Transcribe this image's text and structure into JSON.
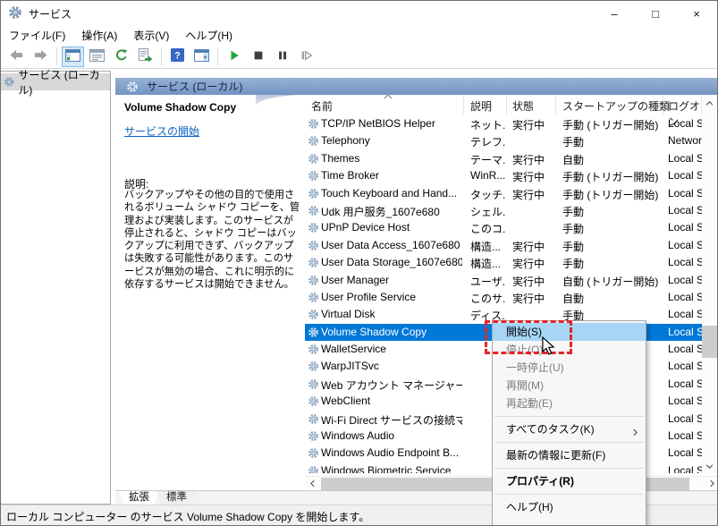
{
  "window": {
    "title": "サービス",
    "controls": {
      "minimize": "–",
      "maximize": "□",
      "close": "×"
    }
  },
  "menubar": {
    "items": [
      {
        "id": "file",
        "label": "ファイル(F)"
      },
      {
        "id": "action",
        "label": "操作(A)"
      },
      {
        "id": "view",
        "label": "表示(V)"
      },
      {
        "id": "help",
        "label": "ヘルプ(H)"
      }
    ]
  },
  "toolbar": {
    "items": [
      "back",
      "forward",
      "|",
      "show-tree",
      "properties",
      "refresh",
      "export-list",
      "|",
      "help",
      "action-pane",
      "|",
      "start-service",
      "stop-service",
      "pause-service",
      "restart-service"
    ]
  },
  "tree": {
    "root": "サービス (ローカル)"
  },
  "panel": {
    "header": "サービス (ローカル)",
    "selected_service": {
      "name": "Volume Shadow Copy",
      "action_link": "サービスの開始",
      "description_label": "説明:",
      "description": "バックアップやその他の目的で使用されるボリューム シャドウ コピーを、管理および実装します。このサービスが停止されると、シャドウ コピーはバックアップに利用できず、バックアップは失敗する可能性があります。このサービスが無効の場合、これに明示的に依存するサービスは開始できません。"
    }
  },
  "table": {
    "columns": [
      "名前",
      "説明",
      "状態",
      "スタートアップの種類",
      "ログオン"
    ],
    "rows": [
      {
        "name": "TCP/IP NetBIOS Helper",
        "desc": "ネット...",
        "status": "実行中",
        "startup": "手動 (トリガー開始)",
        "logon": "Local S",
        "selected": false
      },
      {
        "name": "Telephony",
        "desc": "テレフ...",
        "status": "",
        "startup": "手動",
        "logon": "Networ",
        "selected": false
      },
      {
        "name": "Themes",
        "desc": "テーマ...",
        "status": "実行中",
        "startup": "自動",
        "logon": "Local S",
        "selected": false
      },
      {
        "name": "Time Broker",
        "desc": "WinR...",
        "status": "実行中",
        "startup": "手動 (トリガー開始)",
        "logon": "Local S",
        "selected": false
      },
      {
        "name": "Touch Keyboard and Hand...",
        "desc": "タッチ...",
        "status": "実行中",
        "startup": "手動 (トリガー開始)",
        "logon": "Local S",
        "selected": false
      },
      {
        "name": "Udk 用户服务_1607e680",
        "desc": "シェル...",
        "status": "",
        "startup": "手動",
        "logon": "Local S",
        "selected": false
      },
      {
        "name": "UPnP Device Host",
        "desc": "このコ...",
        "status": "",
        "startup": "手動",
        "logon": "Local S",
        "selected": false
      },
      {
        "name": "User Data Access_1607e680",
        "desc": "構造...",
        "status": "実行中",
        "startup": "手動",
        "logon": "Local S",
        "selected": false
      },
      {
        "name": "User Data Storage_1607e680",
        "desc": "構造...",
        "status": "実行中",
        "startup": "手動",
        "logon": "Local S",
        "selected": false
      },
      {
        "name": "User Manager",
        "desc": "ユーザ...",
        "status": "実行中",
        "startup": "自動 (トリガー開始)",
        "logon": "Local S",
        "selected": false
      },
      {
        "name": "User Profile Service",
        "desc": "このサ...",
        "status": "実行中",
        "startup": "自動",
        "logon": "Local S",
        "selected": false
      },
      {
        "name": "Virtual Disk",
        "desc": "ディス...",
        "status": "",
        "startup": "手動",
        "logon": "Local S",
        "selected": false
      },
      {
        "name": "Volume Shadow Copy",
        "desc": "",
        "status": "",
        "startup": "",
        "logon": "Local S",
        "selected": true
      },
      {
        "name": "WalletService",
        "desc": "",
        "status": "",
        "startup": "",
        "logon": "Local S",
        "selected": false
      },
      {
        "name": "WarpJITSvc",
        "desc": "",
        "status": "",
        "startup": "",
        "logon": "Local S",
        "selected": false
      },
      {
        "name": "Web アカウント マネージャー",
        "desc": "",
        "status": "",
        "startup": "",
        "logon": "Local S",
        "selected": false
      },
      {
        "name": "WebClient",
        "desc": "",
        "status": "",
        "startup": "",
        "logon": "Local S",
        "selected": false
      },
      {
        "name": "Wi-Fi Direct サービスの接続マ...",
        "desc": "",
        "status": "",
        "startup": "",
        "logon": "Local S",
        "selected": false
      },
      {
        "name": "Windows Audio",
        "desc": "",
        "status": "",
        "startup": "",
        "logon": "Local S",
        "selected": false
      },
      {
        "name": "Windows Audio Endpoint B...",
        "desc": "",
        "status": "",
        "startup": "",
        "logon": "Local S",
        "selected": false
      },
      {
        "name": "Windows Biometric Service",
        "desc": "",
        "status": "",
        "startup": "",
        "logon": "Local S",
        "selected": false
      }
    ]
  },
  "tabs": [
    {
      "id": "extended",
      "label": "拡張",
      "active": true
    },
    {
      "id": "standard",
      "label": "標準",
      "active": false
    }
  ],
  "context_menu": {
    "items": [
      {
        "id": "start",
        "label": "開始(S)",
        "state": "highlighted"
      },
      {
        "id": "stop",
        "label": "停止(O)",
        "state": "disabled"
      },
      {
        "id": "pause",
        "label": "一時停止(U)",
        "state": "disabled"
      },
      {
        "id": "resume",
        "label": "再開(M)",
        "state": "disabled"
      },
      {
        "id": "restart",
        "label": "再起動(E)",
        "state": "disabled"
      },
      {
        "type": "separator"
      },
      {
        "id": "all-tasks",
        "label": "すべてのタスク(K)",
        "state": "normal",
        "submenu": true
      },
      {
        "type": "separator"
      },
      {
        "id": "refresh",
        "label": "最新の情報に更新(F)",
        "state": "normal"
      },
      {
        "type": "separator"
      },
      {
        "id": "properties",
        "label": "プロパティ(R)",
        "state": "normal",
        "bold": true
      },
      {
        "type": "separator"
      },
      {
        "id": "help",
        "label": "ヘルプ(H)",
        "state": "normal"
      }
    ]
  },
  "statusbar": {
    "text": "ローカル コンピューター のサービス Volume Shadow Copy を開始します。"
  }
}
